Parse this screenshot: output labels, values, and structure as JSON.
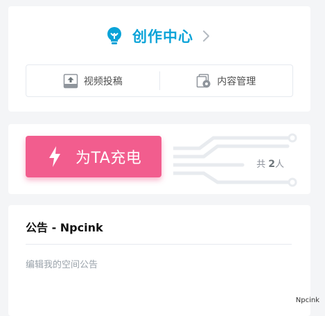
{
  "creation_center": {
    "title": "创作中心",
    "actions": [
      {
        "label": "视频投稿",
        "icon": "upload-icon"
      },
      {
        "label": "内容管理",
        "icon": "content-manage-icon"
      }
    ]
  },
  "charge": {
    "button_label": "为TA充电",
    "count_prefix": "共",
    "count_value": "2",
    "count_suffix": "人"
  },
  "notice": {
    "title": "公告 - Npcink",
    "placeholder": "编辑我的空间公告"
  },
  "watermark": "Npcink",
  "colors": {
    "accent": "#0aa3d8",
    "charge": "#f25d8e",
    "muted": "#99a2aa"
  }
}
